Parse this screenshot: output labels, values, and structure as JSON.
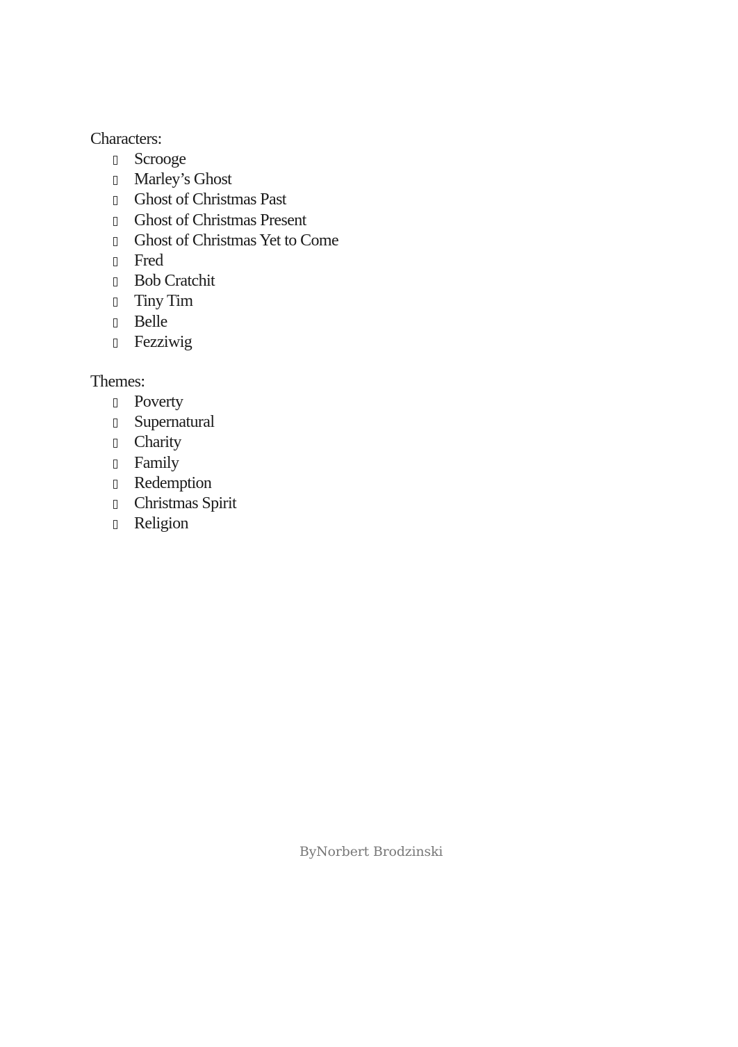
{
  "document": {
    "sections": [
      {
        "heading": "Characters:",
        "items": [
          "Scrooge",
          "Marley’s Ghost",
          "Ghost of Christmas Past",
          "Ghost of Christmas Present",
          "Ghost of Christmas Yet to Come",
          "Fred",
          "Bob Cratchit",
          "Tiny Tim",
          "Belle",
          "Fezziwig"
        ]
      },
      {
        "heading": "Themes:",
        "items": [
          "Poverty",
          "Supernatural",
          "Charity",
          "Family",
          "Redemption",
          "Christmas Spirit",
          "Religion"
        ]
      }
    ],
    "bullet_icon": "missing-glyph-box-icon",
    "footer": "ByNorbert Brodzinski"
  },
  "colors": {
    "text": "#1a1a1a",
    "footer_text": "#767676",
    "background": "#ffffff"
  }
}
